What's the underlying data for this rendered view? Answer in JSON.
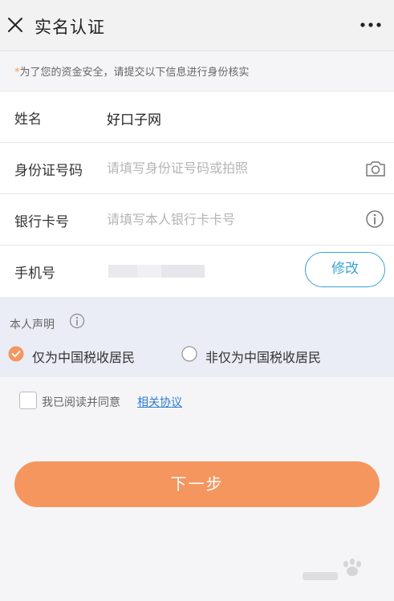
{
  "header": {
    "title": "实名认证",
    "close_icon": "close-icon",
    "more_icon": "more-icon"
  },
  "notice": {
    "star": "*",
    "text": "为了您的资金安全，请提交以下信息进行身份核实"
  },
  "form": {
    "name": {
      "label": "姓名",
      "value": "好口子网"
    },
    "id_number": {
      "label": "身份证号码",
      "placeholder": "请填写身份证号码或拍照",
      "icon": "camera-icon"
    },
    "bank_card": {
      "label": "银行卡号",
      "placeholder": "请填写本人银行卡卡号",
      "icon": "info-icon"
    },
    "phone": {
      "label": "手机号",
      "modify_label": "修改"
    }
  },
  "declaration": {
    "title": "本人声明",
    "options": [
      {
        "label": "仅为中国税收居民",
        "selected": true
      },
      {
        "label": "非仅为中国税收居民",
        "selected": false
      }
    ]
  },
  "agreement": {
    "text": "我已阅读并同意",
    "link": "相关协议"
  },
  "next_button": "下一步",
  "colors": {
    "accent_orange": "#f4965e",
    "link_blue": "#2e7dd1",
    "button_outline_blue": "#3ba3d6"
  }
}
